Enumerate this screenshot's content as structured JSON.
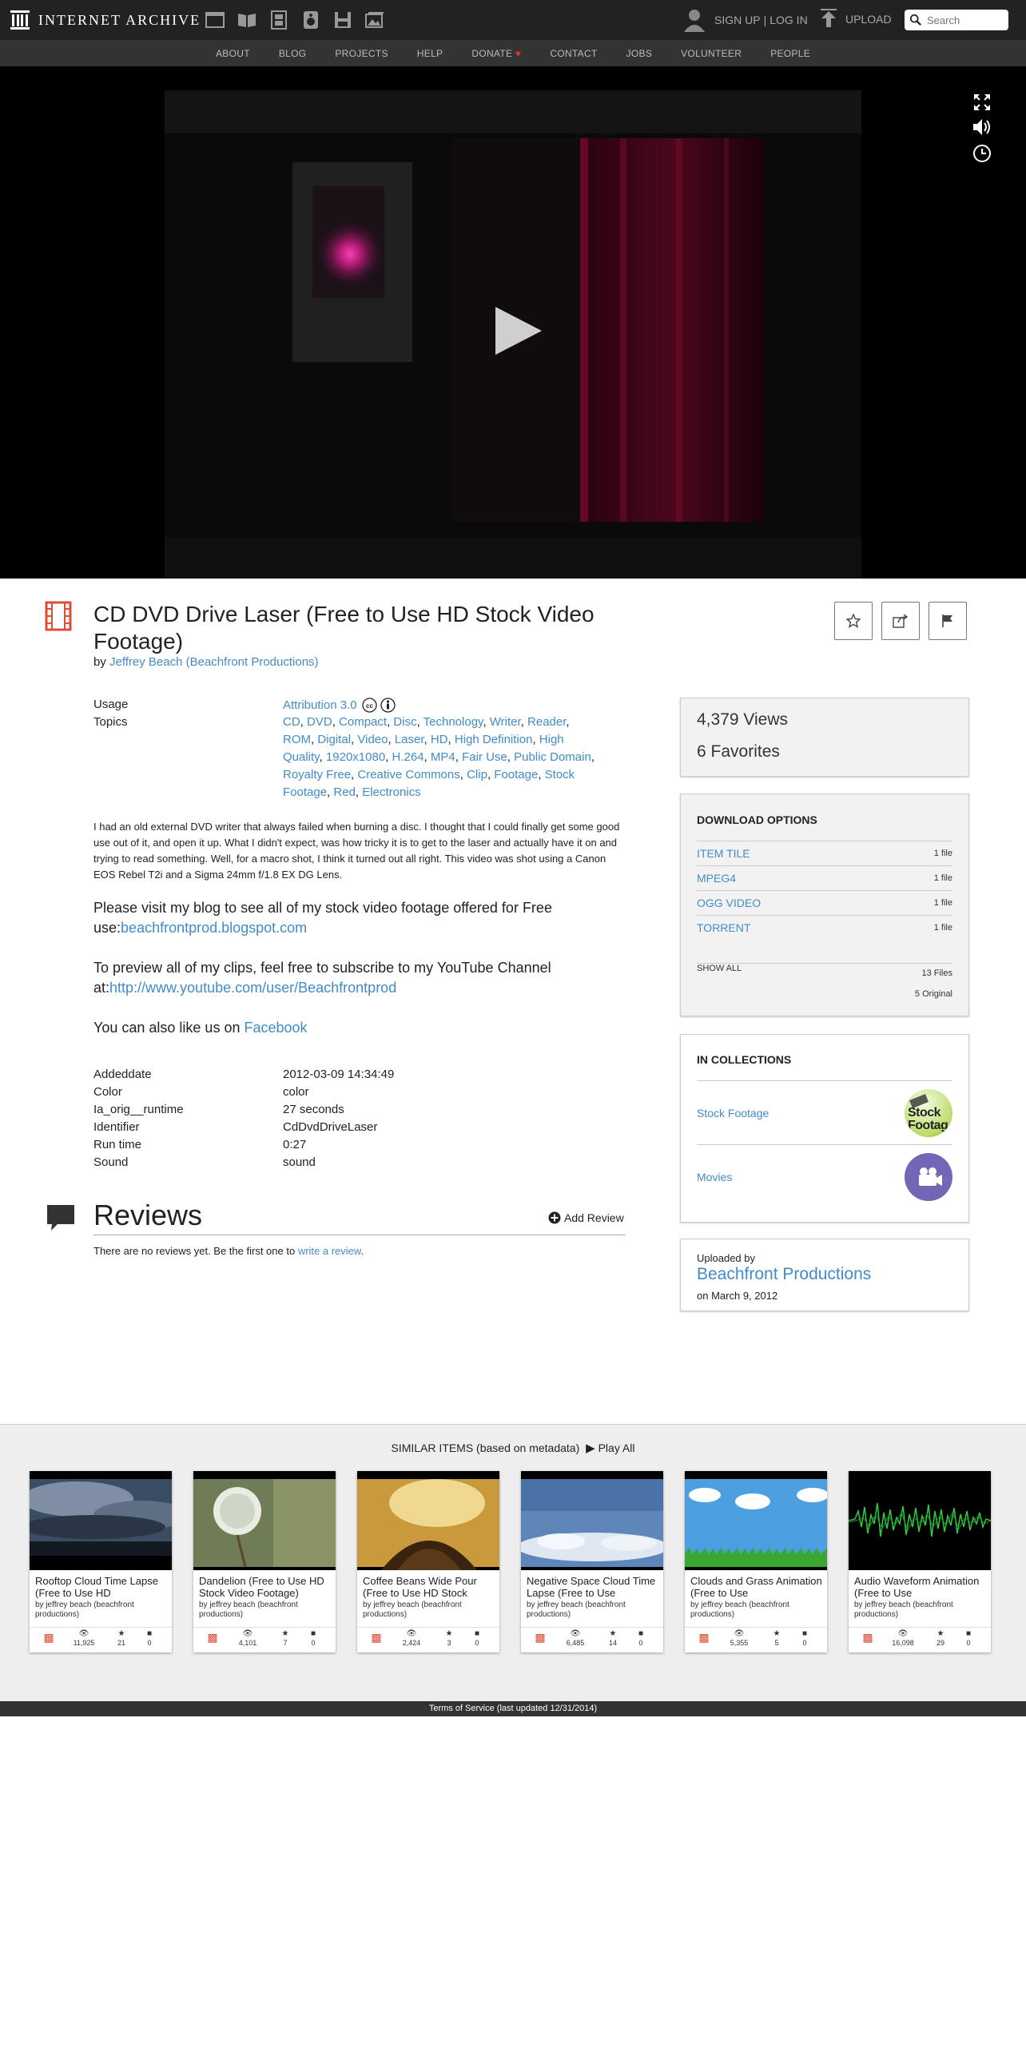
{
  "header": {
    "logo_text": "INTERNET ARCHIVE",
    "signup": "SIGN UP",
    "separator": "|",
    "login": "LOG IN",
    "upload": "UPLOAD",
    "search_placeholder": "Search"
  },
  "nav": {
    "about": "ABOUT",
    "blog": "BLOG",
    "projects": "PROJECTS",
    "help": "HELP",
    "donate": "DONATE",
    "contact": "CONTACT",
    "jobs": "JOBS",
    "volunteer": "VOLUNTEER",
    "people": "PEOPLE"
  },
  "item": {
    "title": "CD DVD Drive Laser (Free to Use HD Stock Video Footage)",
    "by_prefix": "by",
    "creator": "Jeffrey Beach (Beachfront Productions)"
  },
  "metadata": {
    "usage_label": "Usage",
    "usage_value": "Attribution 3.0",
    "topics_label": "Topics",
    "topics": [
      "CD",
      "DVD",
      "Compact",
      "Disc",
      "Technology",
      "Writer",
      "Reader",
      "ROM",
      "Digital",
      "Video",
      "Laser",
      "HD",
      "High Definition",
      "High Quality",
      "1920x1080",
      "H.264",
      "MP4",
      "Fair Use",
      "Public Domain",
      "Royalty Free",
      "Creative Commons",
      "Clip",
      "Footage",
      "Stock Footage",
      "Red",
      "Electronics"
    ]
  },
  "description": {
    "text": "I had an old external DVD writer that always failed when burning a disc. I thought that I could finally get some good use out of it, and open it up. What I didn't expect, was how tricky it is to get to the laser and actually have it on and trying to read something. Well, for a macro shot, I think it turned out all right. This video was shot using a Canon EOS Rebel T2i and a Sigma 24mm f/1.8 EX DG Lens.",
    "blog_text": "Please visit my blog to see all of my stock video footage offered for Free use:",
    "blog_link": "beachfrontprod.blogspot.com",
    "youtube_text": "To preview all of my clips, feel free to subscribe to my YouTube Channel at:",
    "youtube_link": "http://www.youtube.com/user/Beachfrontprod",
    "facebook_text": "You can also like us on",
    "facebook_link": "Facebook"
  },
  "details": [
    {
      "label": "Addeddate",
      "value": "2012-03-09 14:34:49"
    },
    {
      "label": "Color",
      "value": "color"
    },
    {
      "label": "Ia_orig__runtime",
      "value": "27 seconds"
    },
    {
      "label": "Identifier",
      "value": "CdDvdDriveLaser"
    },
    {
      "label": "Run time",
      "value": "0:27"
    },
    {
      "label": "Sound",
      "value": "sound"
    }
  ],
  "reviews": {
    "heading": "Reviews",
    "add_review": "Add Review",
    "empty_text": "There are no reviews yet. Be the first one to",
    "write_link": "write a review",
    "period": "."
  },
  "stats": {
    "views": "4,379 Views",
    "favorites": "6 Favorites"
  },
  "download": {
    "heading": "DOWNLOAD OPTIONS",
    "options": [
      {
        "label": "ITEM TILE",
        "count": "1 file"
      },
      {
        "label": "MPEG4",
        "count": "1 file"
      },
      {
        "label": "OGG VIDEO",
        "count": "1 file"
      },
      {
        "label": "TORRENT",
        "count": "1 file"
      }
    ],
    "show_all": "SHOW ALL",
    "total_files": "13 Files",
    "original": "5 Original"
  },
  "collections": {
    "heading": "IN COLLECTIONS",
    "items": [
      {
        "label": "Stock Footage",
        "thumb_text": "Stock Footag"
      },
      {
        "label": "Movies"
      }
    ]
  },
  "uploader": {
    "label": "Uploaded by",
    "name": "Beachfront Productions",
    "date_prefix": "on",
    "date": "March 9, 2012"
  },
  "similar": {
    "heading": "SIMILAR ITEMS (based on metadata)",
    "play_all": "Play All",
    "items": [
      {
        "title": "Rooftop Cloud Time Lapse (Free to Use HD",
        "by": "by jeffrey beach (beachfront productions)",
        "views": "11,925",
        "favs": "21",
        "reviews": "0"
      },
      {
        "title": "Dandelion (Free to Use HD Stock Video Footage)",
        "by": "by jeffrey beach (beachfront productions)",
        "views": "4,101",
        "favs": "7",
        "reviews": "0"
      },
      {
        "title": "Coffee Beans Wide Pour (Free to Use HD Stock",
        "by": "by jeffrey beach (beachfront productions)",
        "views": "2,424",
        "favs": "3",
        "reviews": "0"
      },
      {
        "title": "Negative Space Cloud Time Lapse (Free to Use",
        "by": "by jeffrey beach (beachfront productions)",
        "views": "6,485",
        "favs": "14",
        "reviews": "0"
      },
      {
        "title": "Clouds and Grass Animation (Free to Use",
        "by": "by jeffrey beach (beachfront productions)",
        "views": "5,355",
        "favs": "5",
        "reviews": "0"
      },
      {
        "title": "Audio Waveform Animation (Free to Use",
        "by": "by jeffrey beach (beachfront productions)",
        "views": "16,098",
        "favs": "29",
        "reviews": "0"
      }
    ]
  },
  "footer": {
    "text": "Terms of Service (last updated 12/31/2014)"
  },
  "colors": {
    "link": "#428bca",
    "topbar": "#222222",
    "navbar": "#333333",
    "accent_red": "#e04c33",
    "movies_purple": "#7465b7"
  }
}
